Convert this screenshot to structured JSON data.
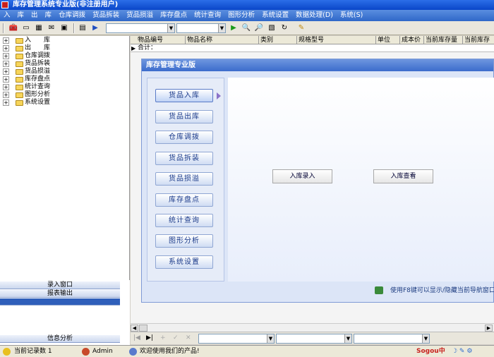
{
  "window": {
    "title": "库存管理系统专业版(非注册用户)"
  },
  "menu": [
    "入",
    "库",
    "出",
    "库",
    "仓库调拨",
    "货品拆装",
    "货品损溢",
    "库存盘点",
    "统计查询",
    "图形分析",
    "系统设置",
    "数据处理(D)",
    "系统(S)"
  ],
  "toolbar": {
    "icons": [
      "toolbox-icon",
      "window-icon",
      "grid-icon",
      "mail-icon",
      "panel-icon",
      "calendar-icon",
      "arrow-icon",
      "play-icon",
      "search-icon",
      "zoom-icon",
      "print-icon",
      "refresh-icon",
      "pencil-icon"
    ]
  },
  "tree": {
    "items": [
      "入　　库",
      "出　　库",
      "仓库调拨",
      "货品拆装",
      "货品损溢",
      "库存盘点",
      "统计查询",
      "图形分析",
      "系统设置"
    ]
  },
  "nav": {
    "tabs": [
      "录入窗口",
      "报表输出",
      "信息分析"
    ]
  },
  "grid": {
    "columns": [
      "物品编号",
      "物品名称",
      "类别",
      "规格型号",
      "单位",
      "成本价",
      "当前库存量",
      "当前库存"
    ],
    "summary_label": "合计："
  },
  "inner": {
    "title": "库存管理专业版",
    "buttons": [
      "货品入库",
      "货品出库",
      "仓库调拨",
      "货品拆装",
      "货品损溢",
      "库存盘点",
      "统计查询",
      "图形分析",
      "系统设置"
    ],
    "actions": [
      "入库录入",
      "入库查看"
    ],
    "hint": "使用F8键可以显示/隐藏当前导航窗口"
  },
  "status": {
    "records_label": "当前记录数 1",
    "user": "Admin",
    "welcome": "欢迎使用我们的产品!",
    "ime": "Sogou中"
  }
}
